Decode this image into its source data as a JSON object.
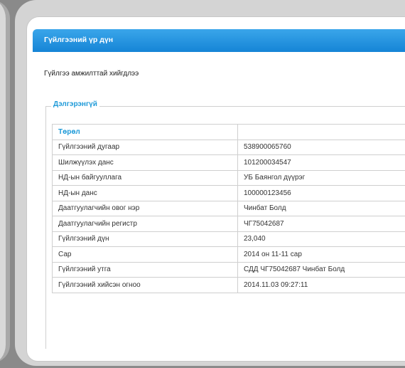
{
  "header": {
    "title": "Гүйлгээний үр дүн"
  },
  "status": {
    "message": "Гүйлгээ амжилттай хийгдлээ"
  },
  "details": {
    "legend": "Дэлгэрэнгүй",
    "column_header": "Төрөл",
    "rows": [
      {
        "label": "Гүйлгээний дугаар",
        "value": "538900065760"
      },
      {
        "label": "Шилжүүлэх данс",
        "value": "101200034547"
      },
      {
        "label": "НД-ын байгууллага",
        "value": "УБ Баянгол дүүрэг"
      },
      {
        "label": "НД-ын данс",
        "value": "100000123456"
      },
      {
        "label": "Даатгуулагчийн овог нэр",
        "value": "Чинбат Болд"
      },
      {
        "label": "Даатгуулагчийн регистр",
        "value": "ЧГ75042687"
      },
      {
        "label": "Гүйлгээний дүн",
        "value": "23,040"
      },
      {
        "label": "Сар",
        "value": "2014 он 11-11 сар"
      },
      {
        "label": "Гүйлгээний утга",
        "value": "СДД ЧГ75042687 Чинбат Болд"
      },
      {
        "label": "Гүйлгээний хийсэн огноо",
        "value": "2014.11.03    09:27:11"
      }
    ]
  },
  "colors": {
    "header": "#1e8fe0",
    "accent": "#1e9ad8",
    "frame": "#d4d4d4"
  }
}
